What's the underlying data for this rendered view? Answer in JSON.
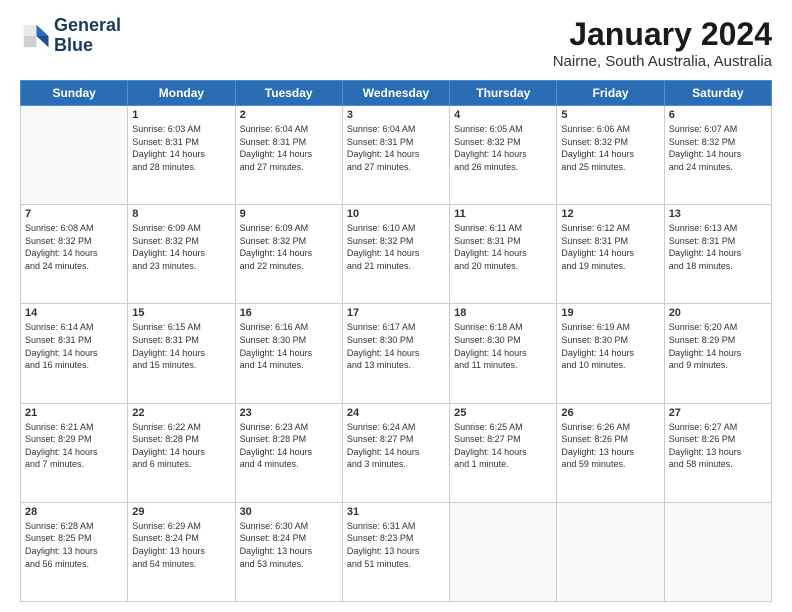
{
  "logo": {
    "line1": "General",
    "line2": "Blue"
  },
  "title": "January 2024",
  "subtitle": "Nairne, South Australia, Australia",
  "days_header": [
    "Sunday",
    "Monday",
    "Tuesday",
    "Wednesday",
    "Thursday",
    "Friday",
    "Saturday"
  ],
  "weeks": [
    [
      {
        "day": "",
        "info": ""
      },
      {
        "day": "1",
        "info": "Sunrise: 6:03 AM\nSunset: 8:31 PM\nDaylight: 14 hours\nand 28 minutes."
      },
      {
        "day": "2",
        "info": "Sunrise: 6:04 AM\nSunset: 8:31 PM\nDaylight: 14 hours\nand 27 minutes."
      },
      {
        "day": "3",
        "info": "Sunrise: 6:04 AM\nSunset: 8:31 PM\nDaylight: 14 hours\nand 27 minutes."
      },
      {
        "day": "4",
        "info": "Sunrise: 6:05 AM\nSunset: 8:32 PM\nDaylight: 14 hours\nand 26 minutes."
      },
      {
        "day": "5",
        "info": "Sunrise: 6:06 AM\nSunset: 8:32 PM\nDaylight: 14 hours\nand 25 minutes."
      },
      {
        "day": "6",
        "info": "Sunrise: 6:07 AM\nSunset: 8:32 PM\nDaylight: 14 hours\nand 24 minutes."
      }
    ],
    [
      {
        "day": "7",
        "info": "Sunrise: 6:08 AM\nSunset: 8:32 PM\nDaylight: 14 hours\nand 24 minutes."
      },
      {
        "day": "8",
        "info": "Sunrise: 6:09 AM\nSunset: 8:32 PM\nDaylight: 14 hours\nand 23 minutes."
      },
      {
        "day": "9",
        "info": "Sunrise: 6:09 AM\nSunset: 8:32 PM\nDaylight: 14 hours\nand 22 minutes."
      },
      {
        "day": "10",
        "info": "Sunrise: 6:10 AM\nSunset: 8:32 PM\nDaylight: 14 hours\nand 21 minutes."
      },
      {
        "day": "11",
        "info": "Sunrise: 6:11 AM\nSunset: 8:31 PM\nDaylight: 14 hours\nand 20 minutes."
      },
      {
        "day": "12",
        "info": "Sunrise: 6:12 AM\nSunset: 8:31 PM\nDaylight: 14 hours\nand 19 minutes."
      },
      {
        "day": "13",
        "info": "Sunrise: 6:13 AM\nSunset: 8:31 PM\nDaylight: 14 hours\nand 18 minutes."
      }
    ],
    [
      {
        "day": "14",
        "info": "Sunrise: 6:14 AM\nSunset: 8:31 PM\nDaylight: 14 hours\nand 16 minutes."
      },
      {
        "day": "15",
        "info": "Sunrise: 6:15 AM\nSunset: 8:31 PM\nDaylight: 14 hours\nand 15 minutes."
      },
      {
        "day": "16",
        "info": "Sunrise: 6:16 AM\nSunset: 8:30 PM\nDaylight: 14 hours\nand 14 minutes."
      },
      {
        "day": "17",
        "info": "Sunrise: 6:17 AM\nSunset: 8:30 PM\nDaylight: 14 hours\nand 13 minutes."
      },
      {
        "day": "18",
        "info": "Sunrise: 6:18 AM\nSunset: 8:30 PM\nDaylight: 14 hours\nand 11 minutes."
      },
      {
        "day": "19",
        "info": "Sunrise: 6:19 AM\nSunset: 8:30 PM\nDaylight: 14 hours\nand 10 minutes."
      },
      {
        "day": "20",
        "info": "Sunrise: 6:20 AM\nSunset: 8:29 PM\nDaylight: 14 hours\nand 9 minutes."
      }
    ],
    [
      {
        "day": "21",
        "info": "Sunrise: 6:21 AM\nSunset: 8:29 PM\nDaylight: 14 hours\nand 7 minutes."
      },
      {
        "day": "22",
        "info": "Sunrise: 6:22 AM\nSunset: 8:28 PM\nDaylight: 14 hours\nand 6 minutes."
      },
      {
        "day": "23",
        "info": "Sunrise: 6:23 AM\nSunset: 8:28 PM\nDaylight: 14 hours\nand 4 minutes."
      },
      {
        "day": "24",
        "info": "Sunrise: 6:24 AM\nSunset: 8:27 PM\nDaylight: 14 hours\nand 3 minutes."
      },
      {
        "day": "25",
        "info": "Sunrise: 6:25 AM\nSunset: 8:27 PM\nDaylight: 14 hours\nand 1 minute."
      },
      {
        "day": "26",
        "info": "Sunrise: 6:26 AM\nSunset: 8:26 PM\nDaylight: 13 hours\nand 59 minutes."
      },
      {
        "day": "27",
        "info": "Sunrise: 6:27 AM\nSunset: 8:26 PM\nDaylight: 13 hours\nand 58 minutes."
      }
    ],
    [
      {
        "day": "28",
        "info": "Sunrise: 6:28 AM\nSunset: 8:25 PM\nDaylight: 13 hours\nand 56 minutes."
      },
      {
        "day": "29",
        "info": "Sunrise: 6:29 AM\nSunset: 8:24 PM\nDaylight: 13 hours\nand 54 minutes."
      },
      {
        "day": "30",
        "info": "Sunrise: 6:30 AM\nSunset: 8:24 PM\nDaylight: 13 hours\nand 53 minutes."
      },
      {
        "day": "31",
        "info": "Sunrise: 6:31 AM\nSunset: 8:23 PM\nDaylight: 13 hours\nand 51 minutes."
      },
      {
        "day": "",
        "info": ""
      },
      {
        "day": "",
        "info": ""
      },
      {
        "day": "",
        "info": ""
      }
    ]
  ]
}
